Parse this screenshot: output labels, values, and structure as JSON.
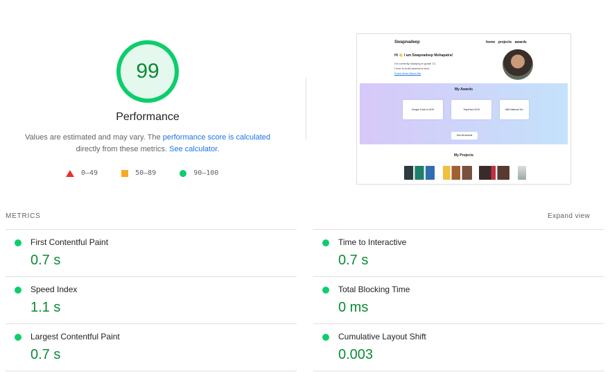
{
  "score": {
    "value": "99",
    "fraction": 0.99,
    "category": "Performance",
    "color": "#0cce6b",
    "track_color": "#e5f8ee"
  },
  "description": {
    "part1": "Values are estimated and may vary. The ",
    "link1": "performance score is calculated",
    "part2": "directly from these metrics. ",
    "link2": "See calculator."
  },
  "legend": [
    {
      "range": "0–49",
      "shape": "triangle",
      "color": "#eb2f2f"
    },
    {
      "range": "50–89",
      "shape": "square",
      "color": "#f9a825"
    },
    {
      "range": "90–100",
      "shape": "circle",
      "color": "#0cce6b"
    }
  ],
  "screenshot": {
    "brand": "Swapnadeep",
    "nav": "home projects awards",
    "greeting": "Hi 👋 I am Swapnadeep Mohapatra!",
    "line1": "I'm currently studying in grade 12.",
    "line2": "I love to build awesome tech",
    "link": "Know More About Me",
    "awards_heading": "My Awards",
    "award_cards": [
      "Google Code-in 2019",
      "TinyoHem 2019",
      "IBM National Tec"
    ],
    "see_all": "See All Awards",
    "projects_heading": "My Projects"
  },
  "metrics": {
    "label": "METRICS",
    "expand": "Expand view",
    "items": [
      {
        "name": "First Contentful Paint",
        "value": "0.7 s"
      },
      {
        "name": "Time to Interactive",
        "value": "0.7 s"
      },
      {
        "name": "Speed Index",
        "value": "1.1 s"
      },
      {
        "name": "Total Blocking Time",
        "value": "0 ms"
      },
      {
        "name": "Largest Contentful Paint",
        "value": "0.7 s"
      },
      {
        "name": "Cumulative Layout Shift",
        "value": "0.003"
      }
    ]
  }
}
